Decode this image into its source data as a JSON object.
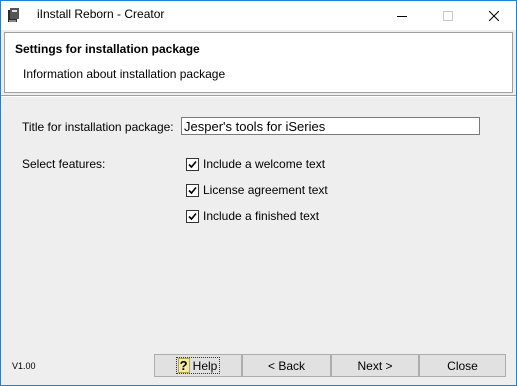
{
  "window": {
    "title": "iInstall Reborn - Creator"
  },
  "header": {
    "title": "Settings for installation package",
    "subtitle": "Information about installation package"
  },
  "form": {
    "title_label": "Title for installation package:",
    "title_value": "Jesper's tools for iSeries",
    "features_label": "Select features:",
    "features": [
      {
        "label": "Include a welcome text",
        "checked": true
      },
      {
        "label": "License agreement text",
        "checked": true
      },
      {
        "label": "Include a finished text",
        "checked": true
      }
    ]
  },
  "footer": {
    "version": "V1.00",
    "help_label": "Help",
    "back_label": "< Back",
    "next_label": "Next >",
    "close_label": "Close"
  },
  "icons": {
    "app": "app-icon",
    "minimize": "minimize-icon",
    "maximize": "maximize-icon",
    "close": "close-icon",
    "help": "help-icon",
    "checkbox": "checkmark-icon"
  },
  "colors": {
    "window_border": "#1883d7",
    "dialog_bg": "#eeeeee",
    "button_bg": "#e1e1e1"
  }
}
